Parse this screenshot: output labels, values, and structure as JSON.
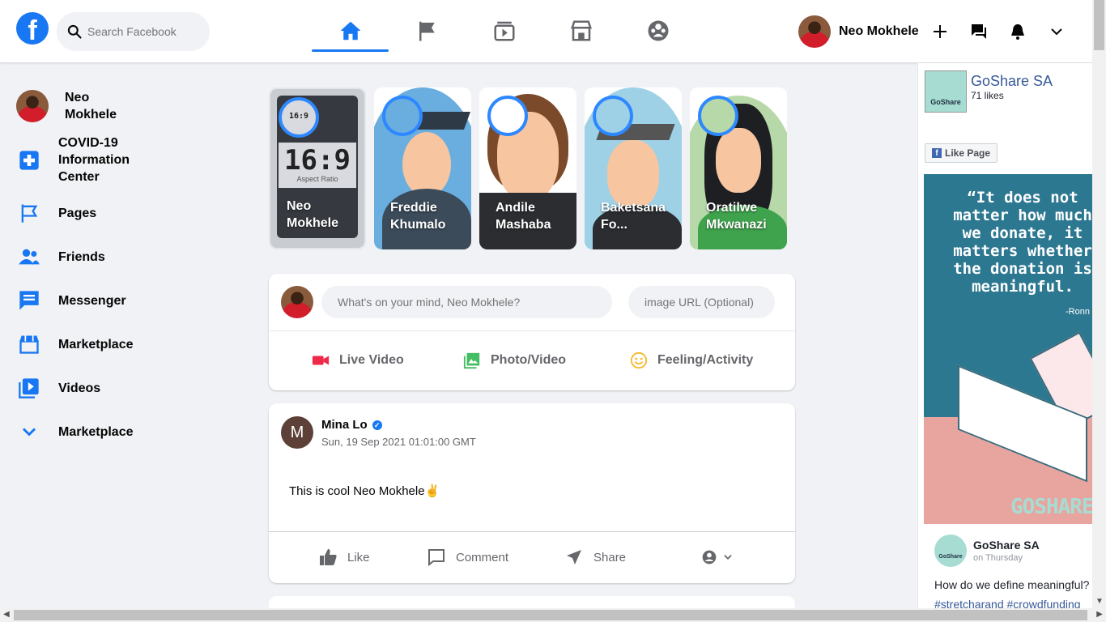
{
  "header": {
    "logo": "f",
    "search_placeholder": "Search Facebook",
    "user_name": "Neo Mokhele",
    "tabs": [
      "home",
      "pages",
      "watch",
      "marketplace",
      "groups"
    ]
  },
  "sidebar": {
    "user": "Neo Mokhele",
    "items": [
      {
        "label": "COVID-19 Information Center",
        "icon": "plus-cross-icon"
      },
      {
        "label": "Pages",
        "icon": "flag-icon"
      },
      {
        "label": "Friends",
        "icon": "friends-icon"
      },
      {
        "label": "Messenger",
        "icon": "message-icon"
      },
      {
        "label": "Marketplace",
        "icon": "store-icon"
      },
      {
        "label": "Videos",
        "icon": "video-icon"
      },
      {
        "label": "Marketplace",
        "icon": "chevron-down-icon"
      }
    ]
  },
  "stories": [
    {
      "name": "Neo Mokhele",
      "main_text": "16:9",
      "sub_text": "Aspect Ratio",
      "mini_text": "16:9"
    },
    {
      "name": "Freddie Khumalo"
    },
    {
      "name": "Andile Mashaba"
    },
    {
      "name": "Baketsana Fo..."
    },
    {
      "name": "Oratilwe Mkwanazi"
    }
  ],
  "composer": {
    "placeholder": "What's on your mind, Neo Mokhele?",
    "url_placeholder": "image URL (Optional)",
    "options": [
      "Live Video",
      "Photo/Video",
      "Feeling/Activity"
    ]
  },
  "post": {
    "avatar_letter": "M",
    "author": "Mina Lo",
    "verified_mark": "✓",
    "timestamp": "Sun, 19 Sep 2021 01:01:00 GMT",
    "text": "This is cool Neo Mokhele✌",
    "actions": [
      "Like",
      "Comment",
      "Share"
    ]
  },
  "widget": {
    "page_name": "GoShare SA",
    "likes": "71 likes",
    "like_button": "Like Page",
    "logo_text": "GoShare",
    "quote": "“It does not matter how much we donate, it matters whether the donation is meaningful.",
    "quote_author": "-Ronn",
    "brand": "GOSHARE",
    "post_author": "GoShare SA",
    "post_when": "on Thursday",
    "post_text": "How do we define meaningful?",
    "post_tags": "#stretcharand #crowdfunding"
  },
  "colors": {
    "brand": "#1877f2",
    "background": "#f0f2f5",
    "live": "#f02849",
    "photo": "#45bd62",
    "feeling": "#f7b928"
  }
}
